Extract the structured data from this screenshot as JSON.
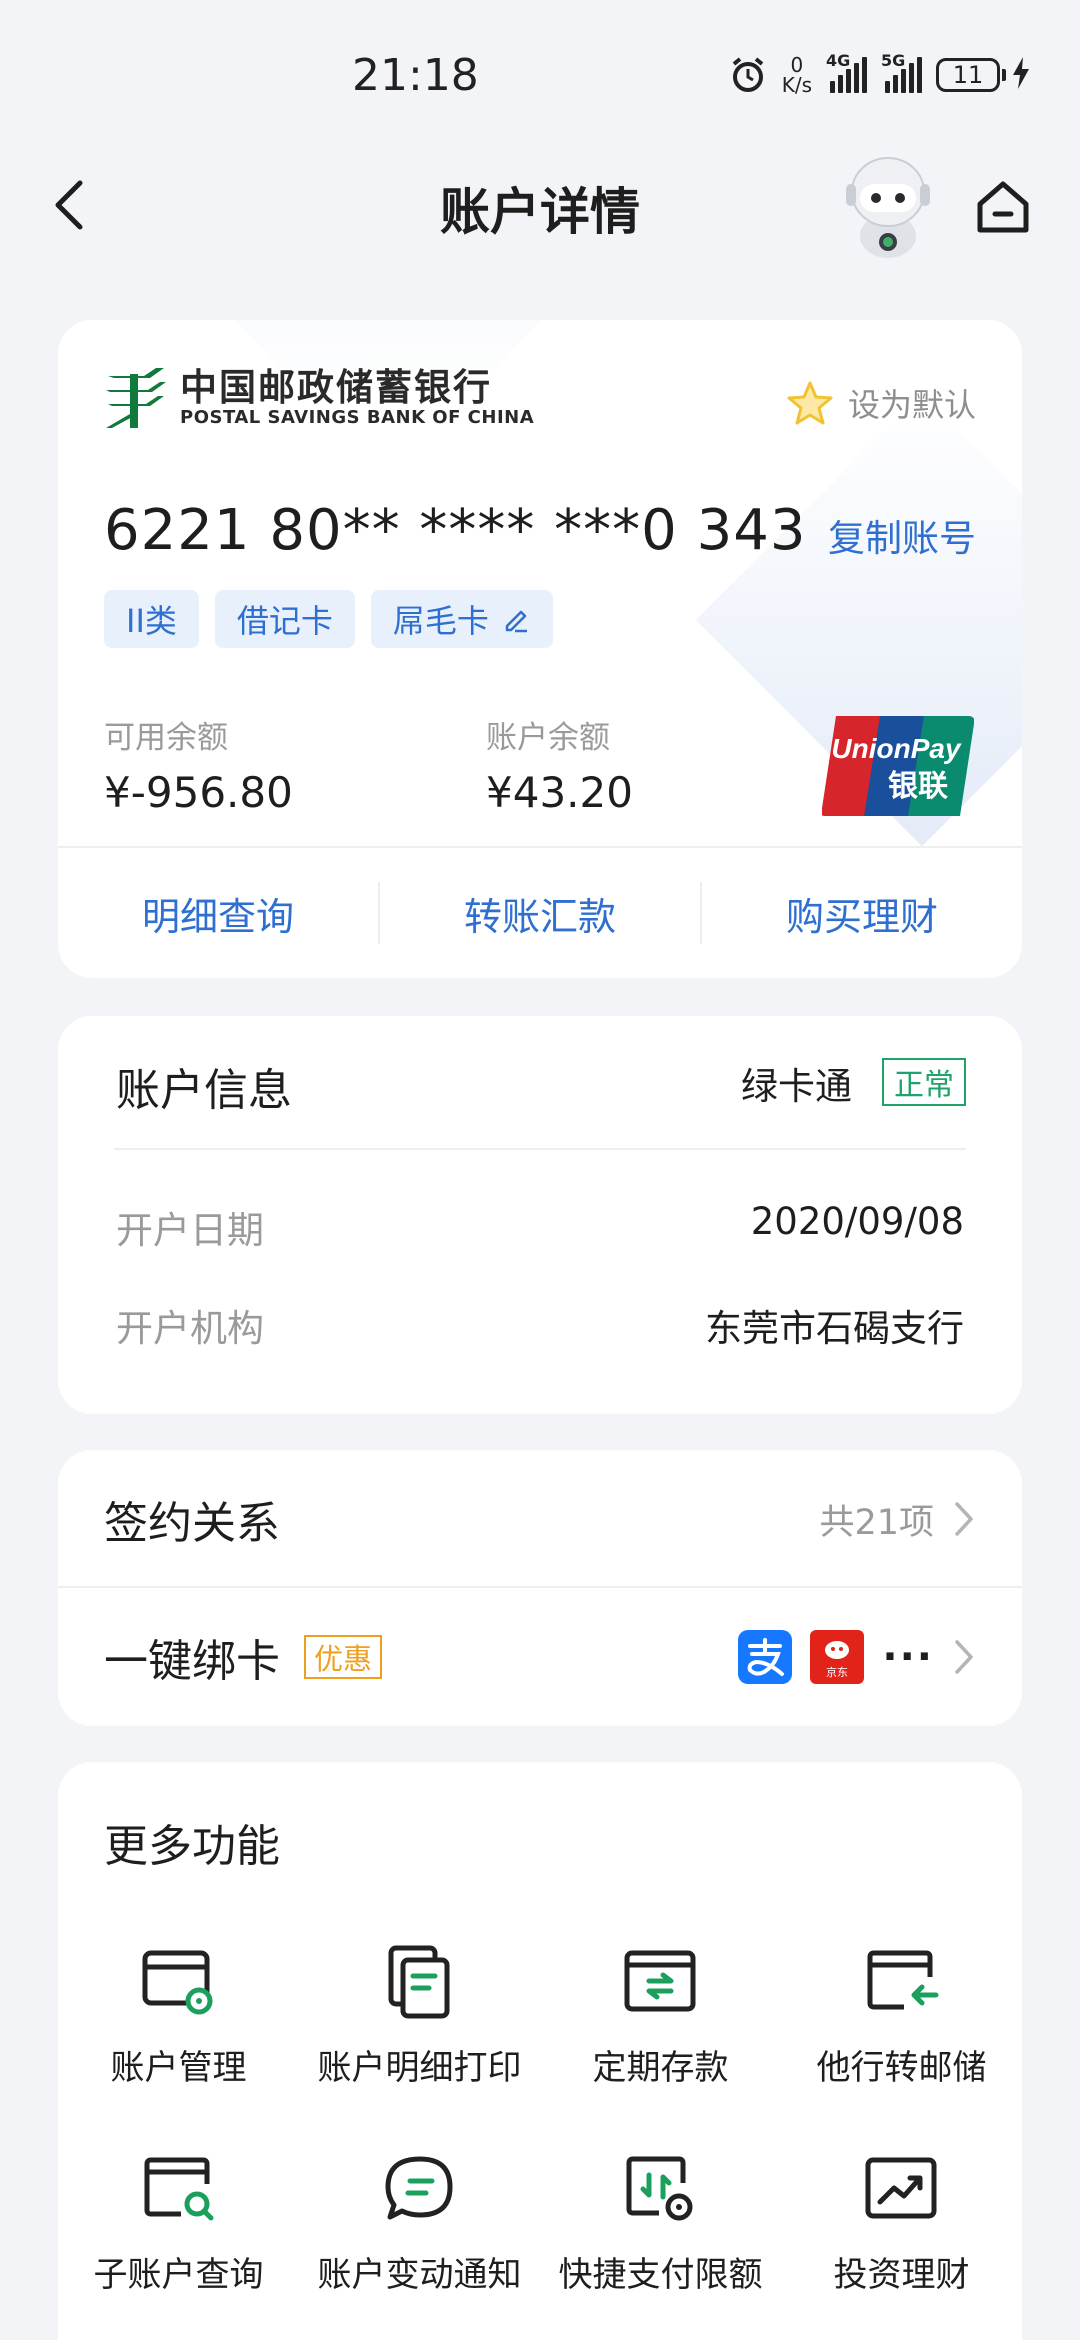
{
  "status_bar": {
    "time": "21:18",
    "net_speed_value": "0",
    "net_speed_unit": "K/s",
    "signal1_tag": "4G",
    "signal2_tag": "5G",
    "battery_level": "11"
  },
  "header": {
    "title": "账户详情"
  },
  "card": {
    "bank_name_cn": "中国邮政储蓄银行",
    "bank_name_en": "POSTAL SAVINGS BANK OF CHINA",
    "set_default_label": "设为默认",
    "account_number": "6221 80** **** ***0 343",
    "copy_label": "复制账号",
    "tags": [
      "II类",
      "借记卡",
      "屌毛卡"
    ],
    "available_label": "可用余额",
    "available_value": "¥-956.80",
    "balance_label": "账户余额",
    "balance_value": "¥43.20",
    "unionpay_text_1": "UnionPay",
    "unionpay_text_2": "银联",
    "actions": [
      "明细查询",
      "转账汇款",
      "购买理财"
    ]
  },
  "account_info": {
    "title": "账户信息",
    "card_type": "绿卡通",
    "status": "正常",
    "rows": [
      {
        "label": "开户日期",
        "value": "2020/09/08"
      },
      {
        "label": "开户机构",
        "value": "东莞市石碣支行"
      }
    ]
  },
  "sign": {
    "title": "签约关系",
    "count": "共21项",
    "bind_title": "一键绑卡",
    "promo": "优惠",
    "jd_label": "京东",
    "more": "···"
  },
  "more": {
    "title": "更多功能",
    "items": [
      {
        "label": "账户管理",
        "icon": "account-manage-icon"
      },
      {
        "label": "账户明细打印",
        "icon": "statement-print-icon"
      },
      {
        "label": "定期存款",
        "icon": "fixed-deposit-icon"
      },
      {
        "label": "他行转邮储",
        "icon": "transfer-in-icon"
      },
      {
        "label": "子账户查询",
        "icon": "sub-account-search-icon"
      },
      {
        "label": "账户变动通知",
        "icon": "change-notice-icon"
      },
      {
        "label": "快捷支付限额",
        "icon": "quick-pay-limit-icon"
      },
      {
        "label": "投资理财",
        "icon": "investment-icon"
      }
    ]
  },
  "colors": {
    "accent_blue": "#2f6fd0",
    "status_green": "#1fa36a",
    "promo_orange": "#f0a020",
    "psbc_green": "#0f7a3c"
  }
}
